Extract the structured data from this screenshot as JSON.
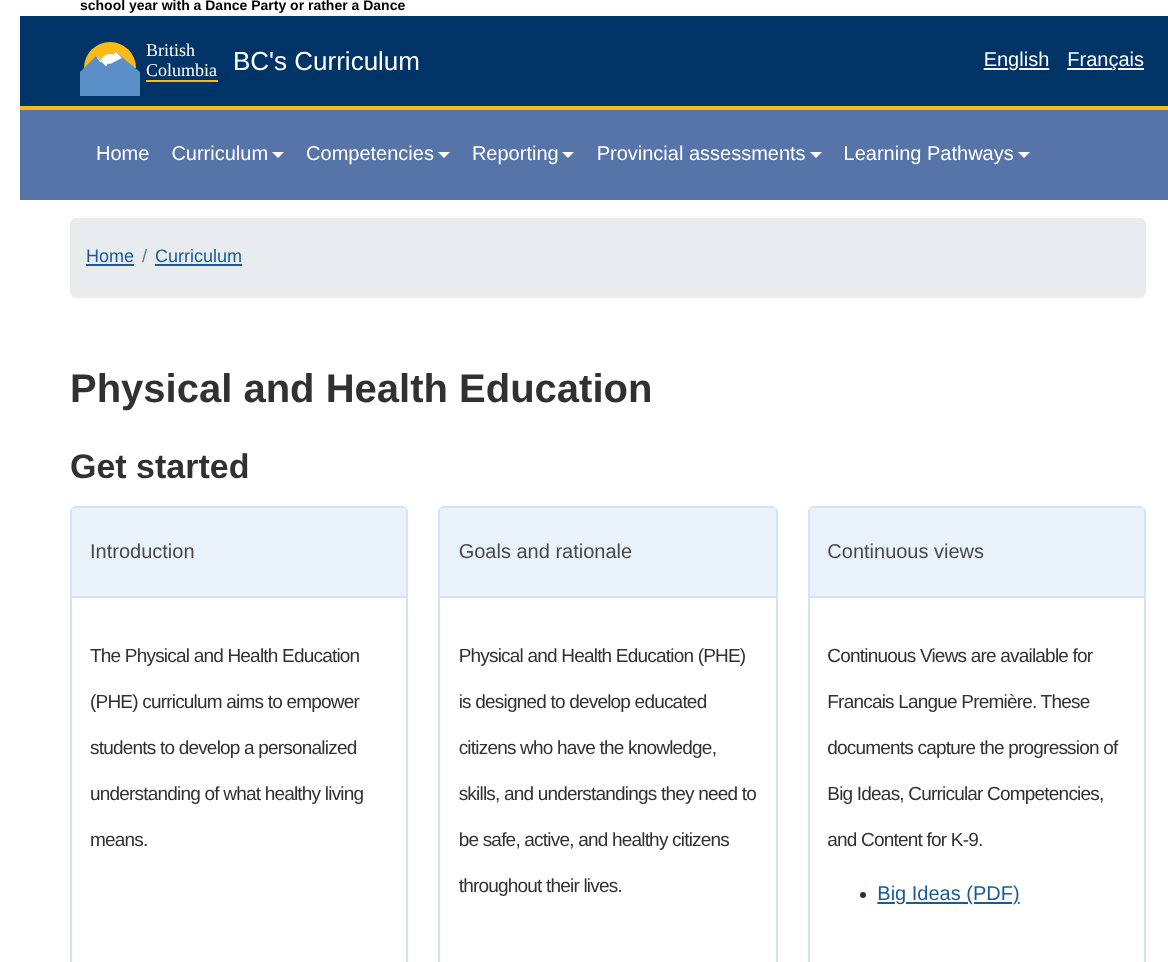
{
  "caption": "school year with a Dance Party or rather a Dance",
  "header": {
    "logo_line_1": "British",
    "logo_line_2": "Columbia",
    "site_title": "BC's Curriculum",
    "languages": [
      "English",
      "Français"
    ]
  },
  "nav": [
    {
      "label": "Home",
      "dropdown": false
    },
    {
      "label": "Curriculum",
      "dropdown": true
    },
    {
      "label": "Competencies",
      "dropdown": true
    },
    {
      "label": "Reporting",
      "dropdown": true
    },
    {
      "label": "Provincial assessments",
      "dropdown": true
    },
    {
      "label": "Learning Pathways",
      "dropdown": true
    }
  ],
  "breadcrumb": [
    "Home",
    "Curriculum"
  ],
  "breadcrumb_separator": "/",
  "title": "Physical and Health Education",
  "section_title": "Get started",
  "cards": [
    {
      "title": "Introduction",
      "body": "The Physical and Health Education (PHE) curriculum aims to empower students to develop a personalized understanding of what healthy living means."
    },
    {
      "title": "Goals and rationale",
      "body": "Physical and Health Education (PHE) is designed to develop educated citizens who have the knowledge, skills, and understandings they need to be safe, active, and healthy citizens throughout their lives."
    },
    {
      "title": "Continuous views",
      "body": "Continuous Views are available for Francais Langue Première. These documents capture the progression of Big Ideas, Curricular Competencies, and Content for K-9.",
      "links": [
        "Big Ideas (PDF)"
      ]
    }
  ]
}
